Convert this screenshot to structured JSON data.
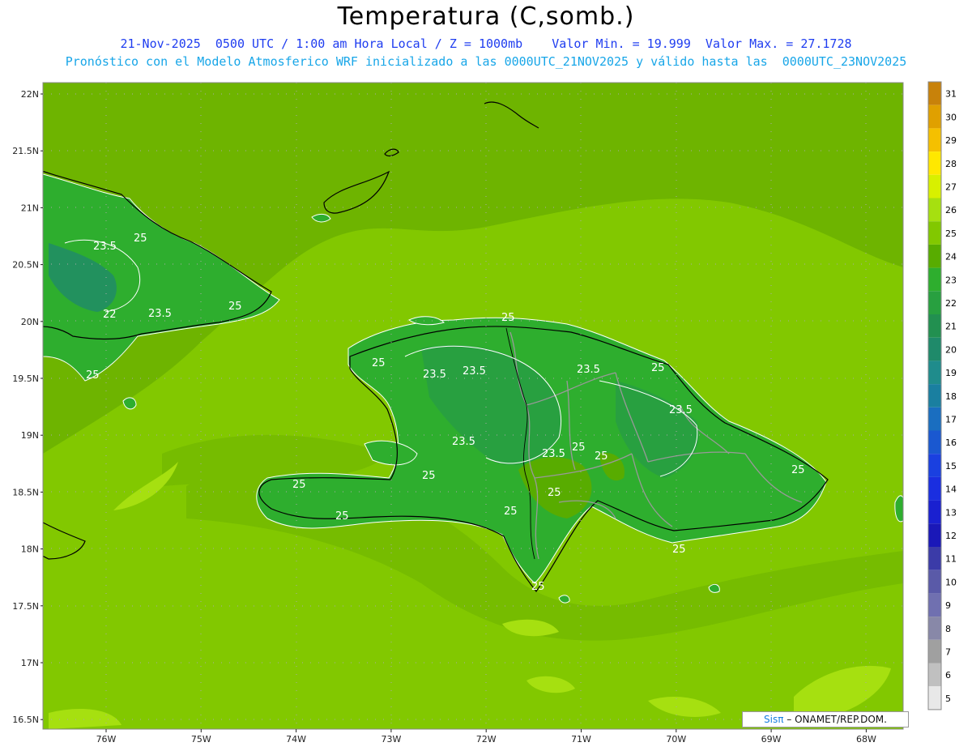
{
  "header": {
    "title": "Temperatura (C,somb.)",
    "line1": "21-Nov-2025  0500 UTC / 1:00 am Hora Local / Z = 1000mb    Valor Min. = 19.999  Valor Max. = 27.1728",
    "line2": "Pronóstico con el Modelo Atmosferico WRF inicializado a las 0000UTC_21NOV2025 y válido hasta las  0000UTC_23NOV2025"
  },
  "axes": {
    "lat_labels": [
      "22N",
      "21.5N",
      "21N",
      "20.5N",
      "20N",
      "19.5N",
      "19N",
      "18.5N",
      "18N",
      "17.5N",
      "17N",
      "16.5N"
    ],
    "lon_labels": [
      "76W",
      "75W",
      "74W",
      "73W",
      "72W",
      "71W",
      "70W",
      "69W",
      "68W"
    ]
  },
  "colorbar": {
    "labels": [
      "31",
      "30",
      "29",
      "28",
      "27",
      "26",
      "25",
      "24",
      "23",
      "22",
      "21",
      "20",
      "19",
      "18",
      "17",
      "16",
      "15",
      "14",
      "13",
      "12",
      "11",
      "10",
      "9",
      "8",
      "7",
      "6",
      "5"
    ],
    "colors": [
      "#c8820a",
      "#e0a000",
      "#f5c000",
      "#ffe800",
      "#d8f000",
      "#a6e010",
      "#82c800",
      "#58ac00",
      "#2eae2e",
      "#28a040",
      "#229050",
      "#1f8a6a",
      "#1f8c8c",
      "#1a7fa0",
      "#1a6ec0",
      "#1a58d0",
      "#1a40e0",
      "#1a2ee0",
      "#1a20d0",
      "#1a18b8",
      "#3b3ba8",
      "#5a5aa8",
      "#7070b0",
      "#8888a8",
      "#a0a0a0",
      "#c0c0c0",
      "#e8e8e8"
    ]
  },
  "contour_labels": [
    "23.5",
    "25",
    "25",
    "22",
    "23.5",
    "25",
    "25",
    "25",
    "23.5",
    "23.5",
    "23.5",
    "25",
    "23.5",
    "23.5",
    "25",
    "23.5",
    "25",
    "25",
    "25",
    "25",
    "25",
    "25",
    "25",
    "25",
    "25"
  ],
  "credit": {
    "sis": "Sisπ",
    "rest": " – ONAMET/REP.DOM."
  }
}
